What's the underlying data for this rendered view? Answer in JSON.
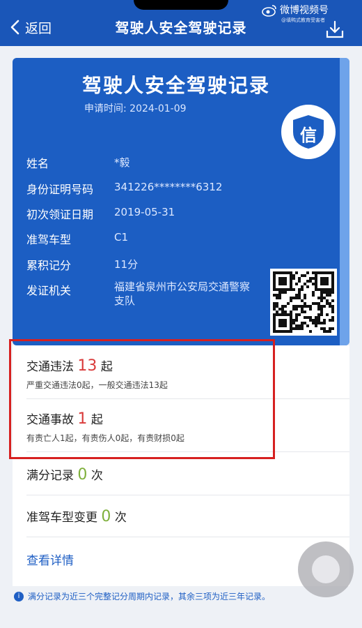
{
  "nav": {
    "back_label": "返回",
    "title": "驾驶人安全驾驶记录"
  },
  "watermark": {
    "name": "微博视频号",
    "sub": "@填鸭式教育受害者"
  },
  "card": {
    "title": "驾驶人安全驾驶记录",
    "apply_date_label": "申请时间:",
    "apply_date": "2024-01-09",
    "badge_char": "信",
    "fields": [
      {
        "label": "姓名",
        "value": "*毅"
      },
      {
        "label": "身份证明号码",
        "value": "341226********6312"
      },
      {
        "label": "初次领证日期",
        "value": "2019-05-31"
      },
      {
        "label": "准驾车型",
        "value": "C1"
      },
      {
        "label": "累积记分",
        "value": "11分"
      },
      {
        "label": "发证机关",
        "value": "福建省泉州市公安局交通警察支队"
      }
    ]
  },
  "records": {
    "violations": {
      "label": "交通违法",
      "count": "13",
      "unit": "起",
      "detail": "严重交通违法0起，一般交通违法13起"
    },
    "accidents": {
      "label": "交通事故",
      "count": "1",
      "unit": "起",
      "detail": "有责亡人1起，有责伤人0起，有责财损0起"
    },
    "full_score": {
      "label": "满分记录",
      "count": "0",
      "unit": "次"
    },
    "license_change": {
      "label": "准驾车型变更",
      "count": "0",
      "unit": "次"
    },
    "details_link": "查看详情"
  },
  "footer_note": "满分记录为近三个完整记分周期内记录，其余三项为近三年记录。",
  "colors": {
    "header_blue": "#1a56b8",
    "card_blue": "#1c5ec3",
    "count_red": "#d93a3a",
    "count_green": "#7fb03c",
    "highlight_red": "#d62020"
  }
}
